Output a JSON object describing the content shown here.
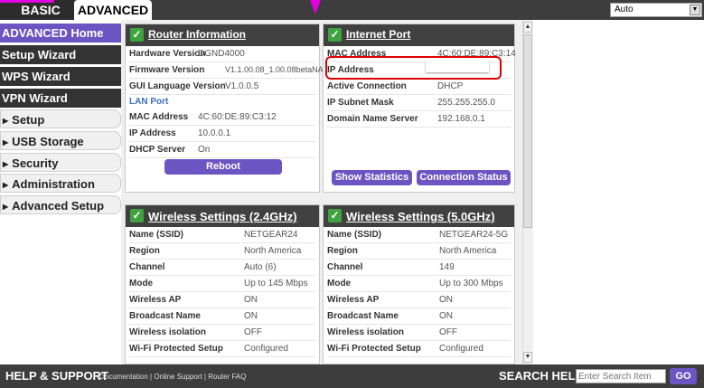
{
  "tabs": {
    "basic": "BASIC",
    "advanced": "ADVANCED"
  },
  "language": {
    "selected": "Auto"
  },
  "nav": {
    "advanced_home": "ADVANCED Home",
    "setup_wizard": "Setup Wizard",
    "wps_wizard": "WPS Wizard",
    "vpn_wizard": "VPN Wizard",
    "setup": "Setup",
    "usb_storage": "USB Storage",
    "security": "Security",
    "administration": "Administration",
    "advanced_setup": "Advanced Setup"
  },
  "router_info": {
    "title": "Router Information",
    "rows": [
      {
        "label": "Hardware Version",
        "value": "DGND4000"
      },
      {
        "label": "Firmware Version",
        "value": "V1.1.00.08_1.00.08betaNA"
      },
      {
        "label": "GUI Language Version",
        "value": "V1.0.0.5"
      }
    ],
    "lan_title": "LAN Port",
    "lan_rows": [
      {
        "label": "MAC Address",
        "value": "4C:60:DE:89:C3:12"
      },
      {
        "label": "IP Address",
        "value": "10.0.0.1"
      },
      {
        "label": "DHCP Server",
        "value": "On"
      }
    ],
    "reboot": "Reboot"
  },
  "internet_port": {
    "title": "Internet Port",
    "rows": [
      {
        "label": "MAC Address",
        "value": "4C:60:DE:89:C3:14"
      },
      {
        "label": "IP Address",
        "value": ""
      },
      {
        "label": "Active Connection",
        "value": "DHCP"
      },
      {
        "label": "IP Subnet Mask",
        "value": "255.255.255.0"
      },
      {
        "label": "Domain Name Server",
        "value": "192.168.0.1"
      }
    ],
    "show_statistics": "Show Statistics",
    "connection_status": "Connection Status"
  },
  "wireless_24": {
    "title": "Wireless Settings (2.4GHz)",
    "rows": [
      {
        "label": "Name (SSID)",
        "value": "NETGEAR24"
      },
      {
        "label": "Region",
        "value": "North America"
      },
      {
        "label": "Channel",
        "value": "Auto (6)"
      },
      {
        "label": "Mode",
        "value": "Up to 145 Mbps"
      },
      {
        "label": "Wireless AP",
        "value": "ON"
      },
      {
        "label": "Broadcast Name",
        "value": "ON"
      },
      {
        "label": "Wireless isolation",
        "value": "OFF"
      },
      {
        "label": "Wi-Fi Protected Setup",
        "value": "Configured"
      }
    ]
  },
  "wireless_50": {
    "title": "Wireless Settings (5.0GHz)",
    "rows": [
      {
        "label": "Name (SSID)",
        "value": "NETGEAR24-5G"
      },
      {
        "label": "Region",
        "value": "North America"
      },
      {
        "label": "Channel",
        "value": "149"
      },
      {
        "label": "Mode",
        "value": "Up to 300 Mbps"
      },
      {
        "label": "Wireless AP",
        "value": "ON"
      },
      {
        "label": "Broadcast Name",
        "value": "ON"
      },
      {
        "label": "Wireless isolation",
        "value": "OFF"
      },
      {
        "label": "Wi-Fi Protected Setup",
        "value": "Configured"
      }
    ]
  },
  "footer": {
    "help_title": "HELP & SUPPORT",
    "documentation": "Documentation",
    "online_support": "Online Support",
    "router_faq": "Router FAQ",
    "search_help": "SEARCH HELP",
    "search_placeholder": "Enter Search Item",
    "go": "GO"
  },
  "colors": {
    "accent": "#6b55c2",
    "highlight": "#e00000",
    "pink": "#e100e1"
  }
}
